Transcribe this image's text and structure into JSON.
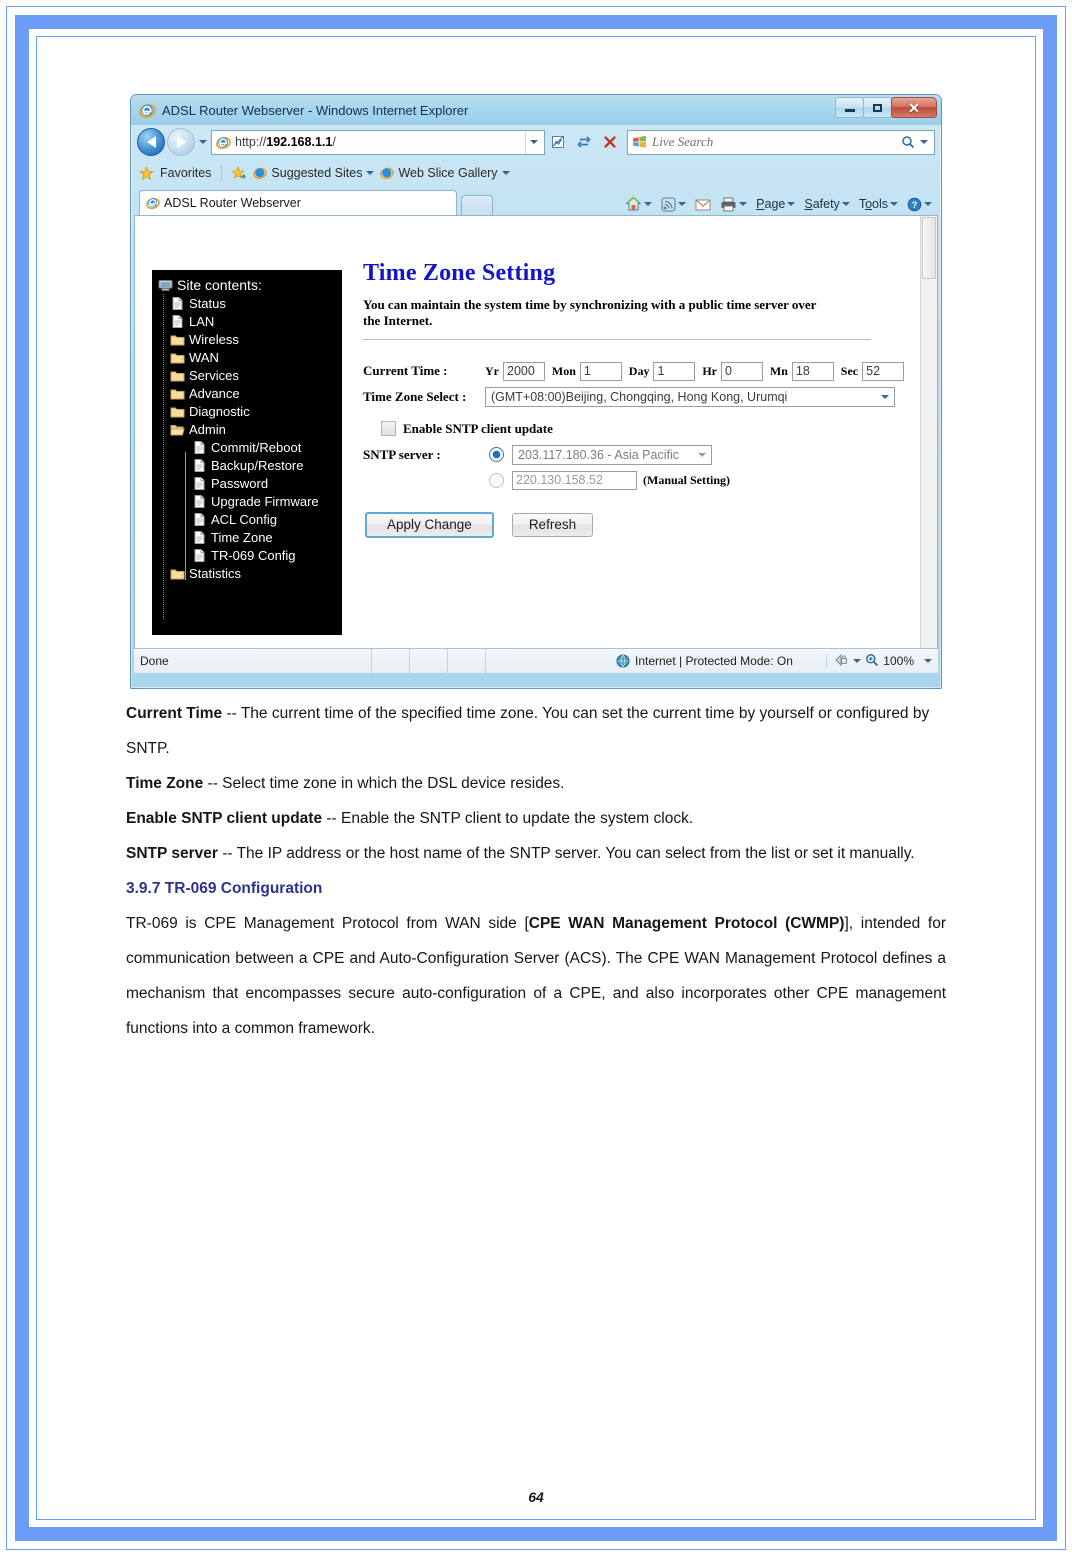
{
  "document": {
    "page_number": "64",
    "paragraphs": [
      {
        "id": "p1",
        "bold_lead": "Current Time",
        "text": " -- The current time of the specified time zone. You can set the current time by yourself or configured by SNTP."
      },
      {
        "id": "p2",
        "bold_lead": "Time Zone",
        "text": " -- Select time zone in which the DSL device resides."
      },
      {
        "id": "p3",
        "bold_lead": "Enable SNTP client update",
        "text": " -- Enable the SNTP client to update the system clock."
      },
      {
        "id": "p4",
        "bold_lead": "SNTP server",
        "text": " -- The IP address or the host name of the SNTP server. You can select from the list or set it manually."
      }
    ],
    "section": {
      "heading": "3.9.7 TR-069 Configuration",
      "body_part1": "TR-069 is CPE Management Protocol from WAN side [",
      "body_bold1": "CPE WAN Management Protocol (CWMP)",
      "body_part2": "], intended for communication between a CPE and Auto-Configuration Server (ACS). The CPE WAN Management Protocol defines a mechanism that encompasses secure auto-configuration of a CPE, and also incorporates other CPE management functions into a common framework."
    }
  },
  "browser": {
    "title": "ADSL Router Webserver - Windows Internet Explorer",
    "window_controls": {
      "minimize": "Minimize",
      "maximize": "Maximize",
      "close": "✕"
    },
    "address": {
      "scheme": "http://",
      "host": "192.168.1.1",
      "path": "/",
      "full": "http://192.168.1.1/"
    },
    "search": {
      "placeholder": "Live Search"
    },
    "favorites_bar": {
      "favorites_label": "Favorites",
      "items": [
        {
          "label": "Suggested Sites",
          "has_caret": true
        },
        {
          "label": "Web Slice Gallery",
          "has_caret": true
        }
      ]
    },
    "tab": {
      "label": "ADSL Router Webserver"
    },
    "command_bar": [
      {
        "label": "",
        "icon": "home-icon",
        "caret": true
      },
      {
        "label": "",
        "icon": "feeds-icon",
        "caret": true
      },
      {
        "label": "",
        "icon": "mail-icon",
        "caret": false
      },
      {
        "label": "",
        "icon": "print-icon",
        "caret": true
      },
      {
        "label": "Page",
        "icon": "",
        "caret": true
      },
      {
        "label": "Safety",
        "icon": "",
        "caret": true
      },
      {
        "label": "Tools",
        "icon": "",
        "caret": true
      },
      {
        "label": "",
        "icon": "help-icon",
        "caret": true
      }
    ],
    "status_bar": {
      "status": "Done",
      "zone": "Internet | Protected Mode: On",
      "zoom": "100%"
    }
  },
  "router_page": {
    "tree": {
      "root_label": "Site contents:",
      "items": [
        {
          "label": "Status",
          "icon": "page-icon",
          "level": 1
        },
        {
          "label": "LAN",
          "icon": "page-icon",
          "level": 1
        },
        {
          "label": "Wireless",
          "icon": "folder-icon",
          "level": 1
        },
        {
          "label": "WAN",
          "icon": "folder-icon",
          "level": 1
        },
        {
          "label": "Services",
          "icon": "folder-icon",
          "level": 1
        },
        {
          "label": "Advance",
          "icon": "folder-icon",
          "level": 1
        },
        {
          "label": "Diagnostic",
          "icon": "folder-icon",
          "level": 1
        },
        {
          "label": "Admin",
          "icon": "folder-open-icon",
          "level": 1
        },
        {
          "label": "Commit/Reboot",
          "icon": "page-icon",
          "level": 2
        },
        {
          "label": "Backup/Restore",
          "icon": "page-icon",
          "level": 2
        },
        {
          "label": "Password",
          "icon": "page-icon",
          "level": 2
        },
        {
          "label": "Upgrade Firmware",
          "icon": "page-icon",
          "level": 2
        },
        {
          "label": "ACL Config",
          "icon": "page-icon",
          "level": 2
        },
        {
          "label": "Time Zone",
          "icon": "page-icon",
          "level": 2
        },
        {
          "label": "TR-069 Config",
          "icon": "page-icon",
          "level": 2
        },
        {
          "label": "Statistics",
          "icon": "folder-icon",
          "level": 1
        }
      ]
    },
    "form": {
      "title": "Time Zone Setting",
      "description": "You can maintain the system time by synchronizing with a public time server over the Internet.",
      "current_time_label": "Current Time :",
      "time_fields": [
        {
          "label": "Yr",
          "value": "2000"
        },
        {
          "label": "Mon",
          "value": "1"
        },
        {
          "label": "Day",
          "value": "1"
        },
        {
          "label": "Hr",
          "value": "0"
        },
        {
          "label": "Mn",
          "value": "18"
        },
        {
          "label": "Sec",
          "value": "52"
        }
      ],
      "timezone_label": "Time Zone Select :",
      "timezone_value": "(GMT+08:00)Beijing, Chongqing, Hong Kong, Urumqi",
      "enable_sntp_label": "Enable SNTP client update",
      "enable_sntp_checked": false,
      "sntp_server_label": "SNTP server :",
      "sntp_preset_value": "203.117.180.36 - Asia Pacific",
      "sntp_preset_selected": true,
      "sntp_manual_value": "220.130.158.52",
      "sntp_manual_selected": false,
      "manual_note": "(Manual Setting)",
      "apply_button": "Apply Change",
      "refresh_button": "Refresh"
    }
  },
  "colors": {
    "page_border": "#6a9cf8",
    "heading_blue": "#2e3191",
    "form_title_blue": "#1414cc",
    "tree_bg": "#000000"
  }
}
